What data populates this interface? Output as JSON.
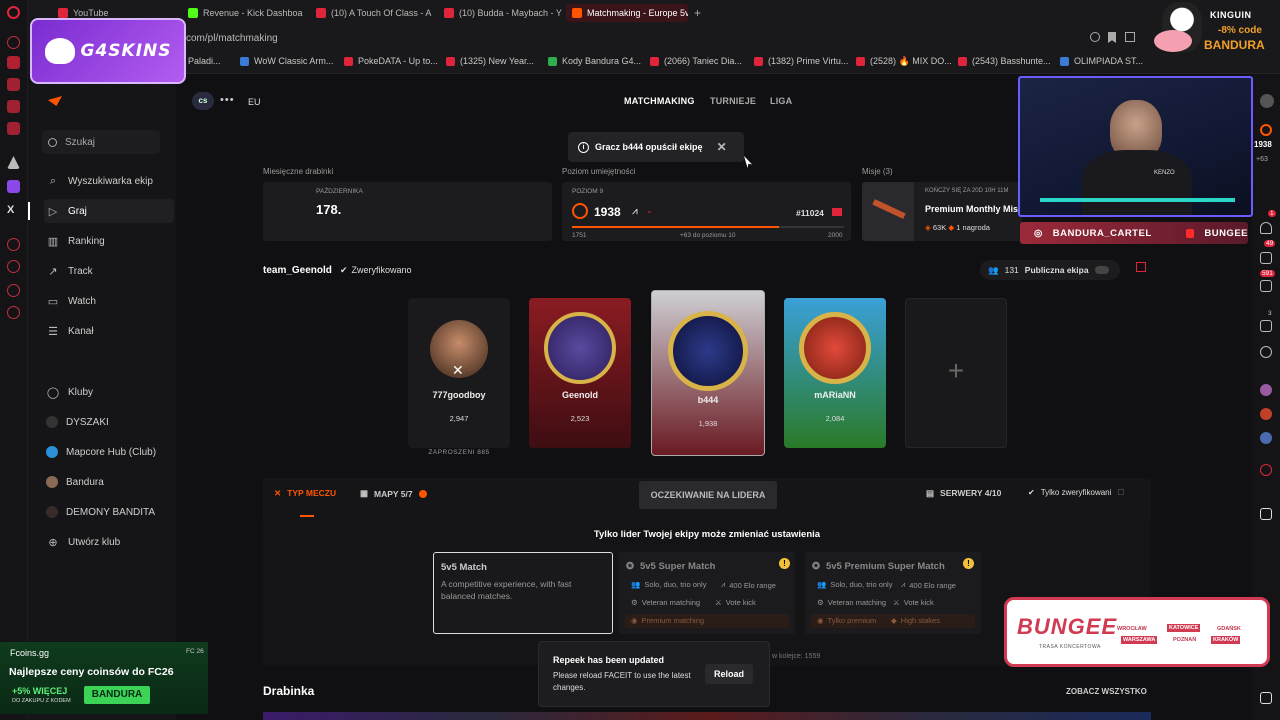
{
  "browser": {
    "tabs": [
      {
        "label": "YouTube"
      },
      {
        "label": "Revenue - Kick Dashboa"
      },
      {
        "label": "(10) A Touch Of Class - A"
      },
      {
        "label": "(10) Budda - Maybach - Y"
      },
      {
        "label": "Matchmaking - Europe 5v"
      }
    ],
    "url": "com/pl/matchmaking",
    "bookmarks": [
      "Paladi...",
      "WoW Classic Arm...",
      "PokeDATA - Up to...",
      "(1325) New Year...",
      "Kody Bandura G4...",
      "(2066) Taniec Dia...",
      "(1382) Prime Virtu...",
      "(2528) 🔥 MIX DO...",
      "(2543) Basshunte...",
      "OLIMPIADA ST..."
    ]
  },
  "overlay": {
    "g4skins": "G4SKINS",
    "kinguin": {
      "brand": "KINGUIN",
      "discount": "-8% code",
      "code": "BANDURA"
    },
    "webcam_shirt": "KENZO",
    "socials": {
      "instagram": "BANDURA_CARTEL",
      "youtube": "BUNGEE"
    },
    "bungee": {
      "title": "BUNGEE",
      "subtitle": "TRASA KONCERTOWA",
      "cities": [
        "WROCŁAW",
        "KATOWICE",
        "GDAŃSK",
        "WARSZAWA",
        "POZNAŃ",
        "KRAKÓW"
      ]
    },
    "fcoins": {
      "brand": "Fcoins.gg",
      "tag": "FC 26",
      "headline": "Najlepsze ceny coinsów do FC26",
      "promo": "+5% WIĘCEJ",
      "promo_sub": "DO ZAKUPU Z KODEM",
      "code": "BANDURA"
    },
    "right_rail": {
      "elo": "1938",
      "gain": "+63",
      "badge1": "49",
      "badge2": "591",
      "badge3": "1",
      "badge4": "3"
    }
  },
  "sidebar": {
    "search_placeholder": "Szukaj",
    "items": [
      {
        "label": "Wyszukiwarka ekip"
      },
      {
        "label": "Graj"
      },
      {
        "label": "Ranking"
      },
      {
        "label": "Track"
      },
      {
        "label": "Watch"
      },
      {
        "label": "Kanał"
      }
    ],
    "clubs": [
      {
        "label": "Kluby"
      },
      {
        "label": "DYSZAKI"
      },
      {
        "label": "Mapcore Hub (Club)"
      },
      {
        "label": "Bandura"
      },
      {
        "label": "DEMONY BANDITA"
      },
      {
        "label": "Utwórz klub"
      }
    ]
  },
  "main": {
    "game": "cs",
    "region": "EU",
    "nav": [
      "MATCHMAKING",
      "TURNIEJE",
      "LIGA"
    ],
    "toast": "Gracz b444 opuścił ekipę",
    "ladder": {
      "label": "Miesięczne drabinki",
      "month": "PAŹDZIERNIKA",
      "place": "178."
    },
    "skill": {
      "label": "Poziom umiejętności",
      "level_label": "POZIOM 9",
      "elo": "1938",
      "rank": "#11024",
      "min": "1751",
      "to_next": "+63 do poziomu 10",
      "max": "2000",
      "progress": 0.76
    },
    "missions": {
      "label": "Misje (3)",
      "ends": "KOŃCZY SIĘ ZA 20D 10H 11M",
      "title": "Premium Monthly Missi...",
      "points": "63K",
      "rewards": "1 nagroda"
    },
    "team": {
      "name": "team_Geenold",
      "verified": "Zweryfikowano",
      "count": "131",
      "public": "Publiczna ekipa"
    },
    "players": [
      {
        "name": "777goodboy",
        "elo": "2,947",
        "note": "ZAPROSZENI 885"
      },
      {
        "name": "Geenold",
        "elo": "2,523"
      },
      {
        "name": "b444",
        "elo": "1,938"
      },
      {
        "name": "mARiaNN",
        "elo": "2,084"
      }
    ],
    "tabs": {
      "match_type": "TYP MECZU",
      "maps": "MAPY 5/7",
      "waiting": "OCZEKIWANIE NA LIDERA",
      "servers": "SERWERY 4/10",
      "verified_only": "Tylko zweryfikowani"
    },
    "leader_note": "Tylko lider Twojej ekipy może zmieniać ustawienia",
    "options": [
      {
        "title": "5v5 Match",
        "desc": "A competitive experience, with fast balanced matches."
      },
      {
        "title": "5v5 Super Match",
        "f1": "Solo, duo, trio only",
        "f2": "400 Elo range",
        "f3": "Veteran matching",
        "f4": "Vote kick",
        "f5": "Premium matching"
      },
      {
        "title": "5v5 Premium Super Match",
        "f1": "Solo, duo, trio only",
        "f2": "400 Elo range",
        "f3": "Veteran matching",
        "f4": "Vote kick",
        "f5": "Tylko premium",
        "f6": "High stakes"
      }
    ],
    "queue_text": "w kolejce: 1559",
    "update": {
      "title": "Repeek has been updated",
      "body": "Please reload FACEIT to use the latest changes.",
      "button": "Reload"
    },
    "ladder_section": "Drabinka",
    "see_all": "ZOBACZ WSZYSTKO"
  }
}
